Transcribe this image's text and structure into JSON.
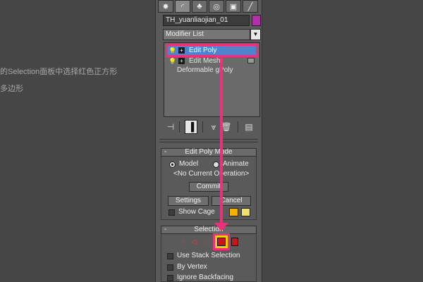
{
  "background_note": {
    "line1": "的Selection面板中选择红色正方形",
    "line2": "多边形"
  },
  "command_tabs": [
    {
      "icon": "create-icon",
      "glyph": "✸"
    },
    {
      "icon": "modify-icon",
      "glyph": "◜"
    },
    {
      "icon": "hierarchy-icon",
      "glyph": "♣"
    },
    {
      "icon": "motion-icon",
      "glyph": "◎"
    },
    {
      "icon": "display-icon",
      "glyph": "▣"
    },
    {
      "icon": "utilities-icon",
      "glyph": "╱"
    }
  ],
  "object_name": "TH_yuanliaojian_01",
  "object_color": "#b030a8",
  "modifier_list": {
    "label": "Modifier List",
    "arrow": "▼"
  },
  "stack": [
    {
      "label": "Edit Poly",
      "bulb": "💡",
      "expander": "+",
      "selected": true
    },
    {
      "label": "Edit Mesh",
      "bulb": "💡",
      "expander": "+",
      "selected": false
    },
    {
      "label": "Deformable gPoly",
      "selected": false
    }
  ],
  "stack_tools": {
    "pin": "⊣",
    "show_end": "▐",
    "make_unique": "⩔",
    "remove": "🗑",
    "configure": "▤"
  },
  "edit_poly_mode": {
    "title": "Edit Poly Mode",
    "collapse": "-",
    "model_label": "Model",
    "animate_label": "Animate",
    "current_op": "<No Current Operation>",
    "commit_label": "Commit",
    "settings_label": "Settings",
    "cancel_label": "Cancel",
    "show_cage_label": "Show Cage",
    "cage_colors": [
      "#f2b400",
      "#f0e070"
    ]
  },
  "selection": {
    "title": "Selection",
    "collapse": "-",
    "levels": [
      {
        "icon": "vertex-icon",
        "glyph": "⁖"
      },
      {
        "icon": "edge-icon",
        "glyph": "◁"
      },
      {
        "icon": "border-icon",
        "glyph": "◌"
      },
      {
        "icon": "polygon-icon",
        "glyph": "■",
        "active": true
      },
      {
        "icon": "element-icon",
        "glyph": "◆"
      }
    ],
    "use_stack_label": "Use Stack Selection",
    "by_vertex_label": "By Vertex",
    "ignore_backfacing_label": "Ignore Backfacing"
  },
  "accent_color": "#e8327a",
  "selected_item_color": "#4e84c9"
}
